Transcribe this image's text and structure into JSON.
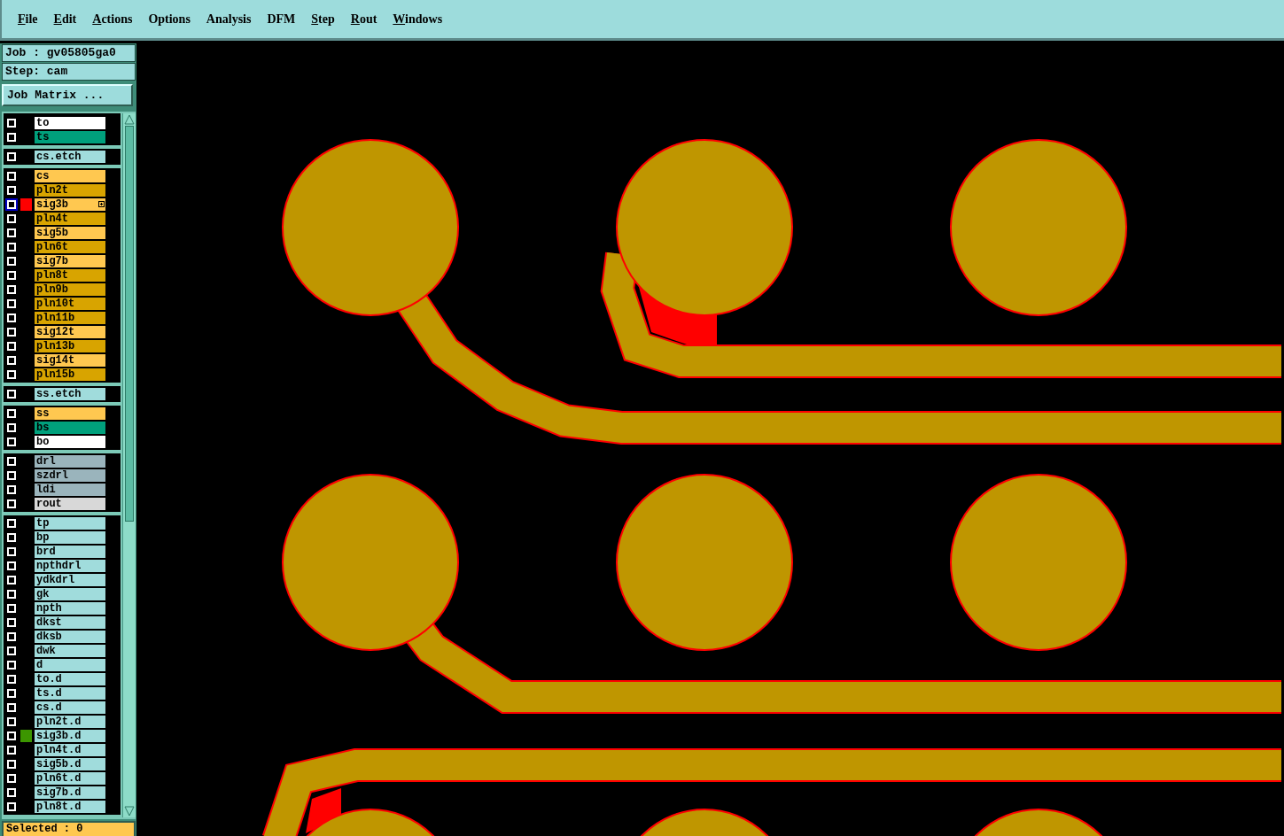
{
  "menu": [
    {
      "label": "File",
      "underlined": true
    },
    {
      "label": "Edit",
      "underlined": true
    },
    {
      "label": "Actions",
      "underlined": true
    },
    {
      "label": "Options",
      "underlined": false
    },
    {
      "label": "Analysis",
      "underlined": false
    },
    {
      "label": "DFM",
      "underlined": false
    },
    {
      "label": "Step",
      "underlined": true
    },
    {
      "label": "Rout",
      "underlined": true
    },
    {
      "label": "Windows",
      "underlined": true
    }
  ],
  "job": "Job : gv05805ga0",
  "step": "Step: cam",
  "job_matrix_button": "Job Matrix ...",
  "layer_groups": [
    [
      {
        "name": "to",
        "color": "#ffffff",
        "checked": false,
        "selected": false,
        "affected": false
      },
      {
        "name": "ts",
        "color": "#00a07c",
        "checked": false,
        "selected": false,
        "affected": false
      }
    ],
    [
      {
        "name": "cs.etch",
        "color": "#a0dcdc",
        "checked": false,
        "selected": false,
        "affected": false
      }
    ],
    [
      {
        "name": "cs",
        "color": "#ffc850",
        "checked": false,
        "selected": false,
        "affected": false
      },
      {
        "name": "pln2t",
        "color": "#d8a400",
        "checked": false,
        "selected": false,
        "affected": false
      },
      {
        "name": "sig3b",
        "color": "#ffc850",
        "checked": false,
        "selected": true,
        "affected": false
      },
      {
        "name": "pln4t",
        "color": "#d8a400",
        "checked": false,
        "selected": false,
        "affected": false
      },
      {
        "name": "sig5b",
        "color": "#ffc850",
        "checked": false,
        "selected": false,
        "affected": false
      },
      {
        "name": "pln6t",
        "color": "#d8a400",
        "checked": false,
        "selected": false,
        "affected": false
      },
      {
        "name": "sig7b",
        "color": "#ffc850",
        "checked": false,
        "selected": false,
        "affected": false
      },
      {
        "name": "pln8t",
        "color": "#d8a400",
        "checked": false,
        "selected": false,
        "affected": false
      },
      {
        "name": "pln9b",
        "color": "#d8a400",
        "checked": false,
        "selected": false,
        "affected": false
      },
      {
        "name": "pln10t",
        "color": "#d8a400",
        "checked": false,
        "selected": false,
        "affected": false
      },
      {
        "name": "pln11b",
        "color": "#d8a400",
        "checked": false,
        "selected": false,
        "affected": false
      },
      {
        "name": "sig12t",
        "color": "#ffc850",
        "checked": false,
        "selected": false,
        "affected": false
      },
      {
        "name": "pln13b",
        "color": "#d8a400",
        "checked": false,
        "selected": false,
        "affected": false
      },
      {
        "name": "sig14t",
        "color": "#ffc850",
        "checked": false,
        "selected": false,
        "affected": false
      },
      {
        "name": "pln15b",
        "color": "#d8a400",
        "checked": false,
        "selected": false,
        "affected": false
      }
    ],
    [
      {
        "name": "ss.etch",
        "color": "#a0dcdc",
        "checked": false,
        "selected": false,
        "affected": false
      }
    ],
    [
      {
        "name": "ss",
        "color": "#ffc850",
        "checked": false,
        "selected": false,
        "affected": false
      },
      {
        "name": "bs",
        "color": "#00a07c",
        "checked": false,
        "selected": false,
        "affected": false
      },
      {
        "name": "bo",
        "color": "#ffffff",
        "checked": false,
        "selected": false,
        "affected": false
      }
    ],
    [
      {
        "name": "drl",
        "color": "#9ab4bc",
        "checked": false,
        "selected": false,
        "affected": false
      },
      {
        "name": "szdrl",
        "color": "#9ab4bc",
        "checked": false,
        "selected": false,
        "affected": false
      },
      {
        "name": "ldi",
        "color": "#9ab4bc",
        "checked": false,
        "selected": false,
        "affected": false
      },
      {
        "name": "rout",
        "color": "#d8d8d8",
        "checked": false,
        "selected": false,
        "affected": false
      }
    ],
    [
      {
        "name": "tp",
        "color": "#a0dcdc",
        "checked": false,
        "selected": false,
        "affected": false
      },
      {
        "name": "bp",
        "color": "#a0dcdc",
        "checked": false,
        "selected": false,
        "affected": false
      },
      {
        "name": "brd",
        "color": "#a0dcdc",
        "checked": false,
        "selected": false,
        "affected": false
      },
      {
        "name": "npthdrl",
        "color": "#a0dcdc",
        "checked": false,
        "selected": false,
        "affected": false
      },
      {
        "name": "ydkdrl",
        "color": "#a0dcdc",
        "checked": false,
        "selected": false,
        "affected": false
      },
      {
        "name": "gk",
        "color": "#a0dcdc",
        "checked": false,
        "selected": false,
        "affected": false
      },
      {
        "name": "npth",
        "color": "#a0dcdc",
        "checked": false,
        "selected": false,
        "affected": false
      },
      {
        "name": "dkst",
        "color": "#a0dcdc",
        "checked": false,
        "selected": false,
        "affected": false
      },
      {
        "name": "dksb",
        "color": "#a0dcdc",
        "checked": false,
        "selected": false,
        "affected": false
      },
      {
        "name": "dwk",
        "color": "#a0dcdc",
        "checked": false,
        "selected": false,
        "affected": false
      },
      {
        "name": "d",
        "color": "#a0dcdc",
        "checked": false,
        "selected": false,
        "affected": false
      },
      {
        "name": "to.d",
        "color": "#a0dcdc",
        "checked": false,
        "selected": false,
        "affected": false
      },
      {
        "name": "ts.d",
        "color": "#a0dcdc",
        "checked": false,
        "selected": false,
        "affected": false
      },
      {
        "name": "cs.d",
        "color": "#a0dcdc",
        "checked": false,
        "selected": false,
        "affected": false
      },
      {
        "name": "pln2t.d",
        "color": "#a0dcdc",
        "checked": false,
        "selected": false,
        "affected": false
      },
      {
        "name": "sig3b.d",
        "color": "#a0dcdc",
        "checked": false,
        "selected": false,
        "affected": true
      },
      {
        "name": "pln4t.d",
        "color": "#a0dcdc",
        "checked": false,
        "selected": false,
        "affected": false
      },
      {
        "name": "sig5b.d",
        "color": "#a0dcdc",
        "checked": false,
        "selected": false,
        "affected": false
      },
      {
        "name": "pln6t.d",
        "color": "#a0dcdc",
        "checked": false,
        "selected": false,
        "affected": false
      },
      {
        "name": "sig7b.d",
        "color": "#a0dcdc",
        "checked": false,
        "selected": false,
        "affected": false
      },
      {
        "name": "pln8t.d",
        "color": "#a0dcdc",
        "checked": false,
        "selected": false,
        "affected": false
      }
    ]
  ],
  "selected_count": "Selected : 0"
}
